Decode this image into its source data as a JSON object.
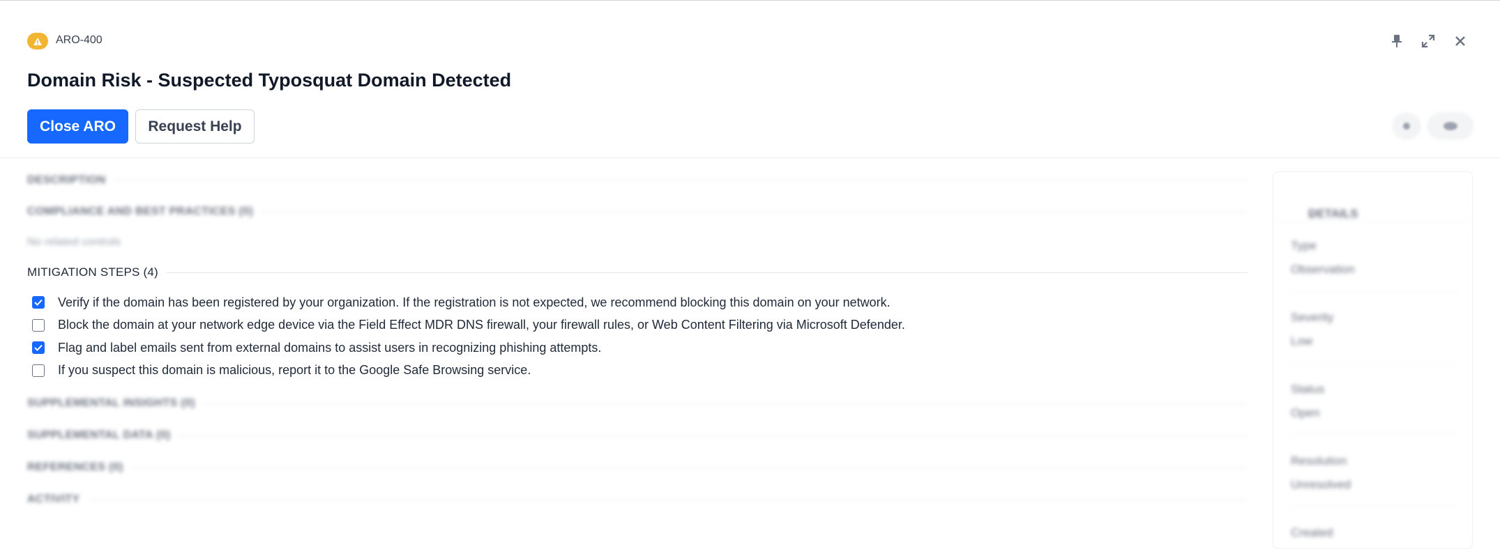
{
  "header": {
    "aro_id": "ARO-400",
    "badge_icon": "warning-triangle-icon",
    "title": "Domain Risk - Suspected Typosquat Domain Detected",
    "primary_action": "Close ARO",
    "secondary_action": "Request Help",
    "window_controls": [
      "pin-icon",
      "expand-icon",
      "close-icon"
    ]
  },
  "sections": {
    "description": "DESCRIPTION",
    "compliance": "COMPLIANCE AND BEST PRACTICES (0)",
    "compliance_empty": "No related controls",
    "mitigation": "MITIGATION STEPS (4)",
    "supplemental_insights": "SUPPLEMENTAL INSIGHTS (0)",
    "supplemental_data": "SUPPLEMENTAL DATA (0)",
    "references": "REFERENCES (0)",
    "activity": "ACTIVITY"
  },
  "mitigation_steps": [
    {
      "text": "Verify if the domain has been registered by your organization. If the registration is not expected, we recommend blocking this domain on your network.",
      "checked": true
    },
    {
      "text": "Block the domain at your network edge device via the Field Effect MDR DNS firewall, your firewall rules, or Web Content Filtering via Microsoft Defender.",
      "checked": false
    },
    {
      "text": "Flag and label emails sent from external domains to assist users in recognizing phishing attempts.",
      "checked": true
    },
    {
      "text": "If you suspect this domain is malicious, report it to the Google Safe Browsing service.",
      "checked": false
    }
  ],
  "details": {
    "heading": "DETAILS",
    "fields": [
      {
        "key": "Type",
        "value": "Observation"
      },
      {
        "key": "Severity",
        "value": "Low"
      },
      {
        "key": "Status",
        "value": "Open"
      },
      {
        "key": "Resolution",
        "value": "Unresolved"
      },
      {
        "key": "Created",
        "value": ""
      }
    ]
  },
  "colors": {
    "primary": "#1668ff",
    "badge": "#f2b532"
  }
}
